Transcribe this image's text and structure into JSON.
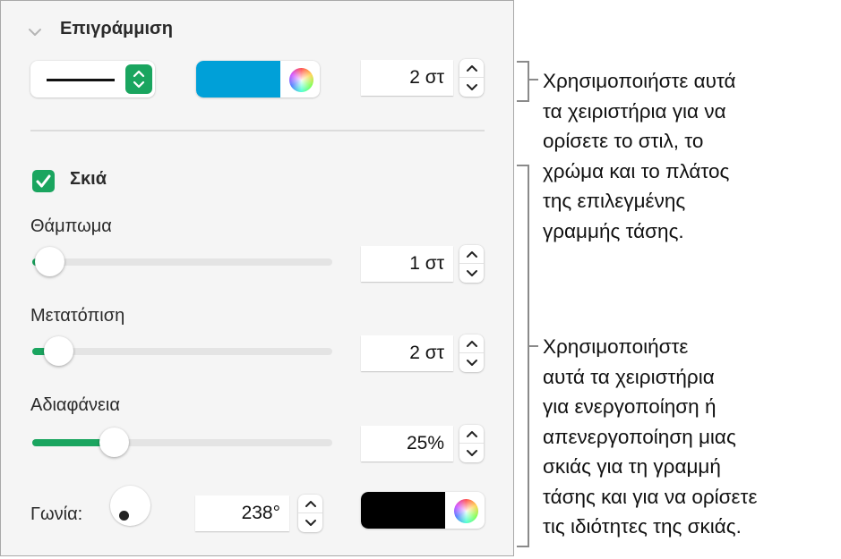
{
  "panel": {
    "outline_section": {
      "title": "Επιγράμμιση",
      "collapse_icon": "chevron-down-icon",
      "line_style": "solid",
      "stroke_color": "#00A0D8",
      "width_value": "2 στ"
    },
    "shadow_section": {
      "enabled": true,
      "title": "Σκιά",
      "blur": {
        "label": "Θάμπωμα",
        "value": "1 στ",
        "slider_fraction": 0.03
      },
      "offset": {
        "label": "Μετατόπιση",
        "value": "2 στ",
        "slider_fraction": 0.06
      },
      "opacity": {
        "label": "Αδιαφάνεια",
        "value": "25%",
        "slider_fraction": 0.25
      },
      "angle": {
        "label": "Γωνία:",
        "value": "238°",
        "degrees": 238
      },
      "shadow_color": "#000000"
    },
    "accent_color": "#1AA55F"
  },
  "callouts": [
    {
      "lines": [
        "Χρησιμοποιήστε αυτά",
        "τα χειριστήρια για να",
        "ορίσετε το στιλ, το",
        "χρώμα και το πλάτος",
        "της επιλεγμένης",
        "γραμμής τάσης."
      ]
    },
    {
      "lines": [
        "Χρησιμοποιήστε",
        "αυτά τα χειριστήρια",
        "για ενεργοποίηση ή",
        "απενεργοποίηση μιας",
        "σκιάς για τη γραμμή",
        "τάσης και για να ορίσετε",
        "τις ιδιότητες της σκιάς."
      ]
    }
  ]
}
